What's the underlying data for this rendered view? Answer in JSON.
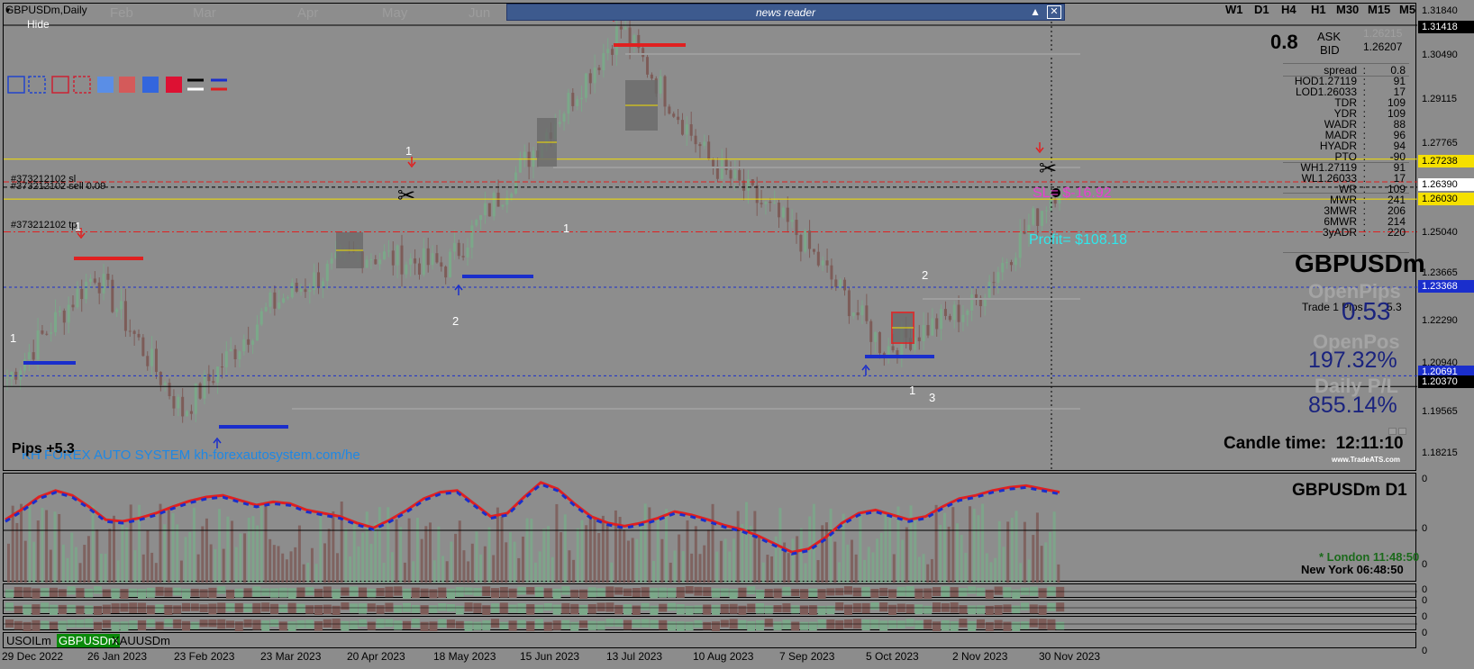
{
  "window": {
    "symbol_title": "GBPUSDm,Daily",
    "hide_label": "Hide"
  },
  "news_reader": {
    "title": "news reader"
  },
  "timeframes": [
    "W1",
    "D1",
    "H4",
    "H1",
    "M30",
    "M15",
    "M5"
  ],
  "month_labels": [
    "Feb",
    "Mar",
    "Apr",
    "May",
    "Jun"
  ],
  "price_axis": {
    "labels": [
      "1.31840",
      "1.31418",
      "1.30490",
      "1.29115",
      "1.27765",
      "1.27238",
      "1.26390",
      "1.26030",
      "1.25040",
      "1.23665",
      "1.23368",
      "1.22290",
      "1.20940",
      "1.20691",
      "1.20370",
      "1.19565",
      "1.18215"
    ],
    "indicator_labels": [
      "0",
      "0",
      "0",
      "0",
      "0",
      "0",
      "0",
      "0"
    ]
  },
  "quote_panel": {
    "spread_big": "0.8",
    "ask_label": "ASK",
    "ask_value": "1.26215",
    "bid_label": "BID",
    "bid_value": "1.26207"
  },
  "stats": [
    {
      "k": "spread",
      "v": "0.8"
    },
    {
      "k": "HOD1.27119",
      "v": "91"
    },
    {
      "k": "LOD1.26033",
      "v": "17"
    },
    {
      "k": "TDR",
      "v": "109"
    },
    {
      "k": "YDR",
      "v": "109"
    },
    {
      "k": "WADR",
      "v": "88"
    },
    {
      "k": "MADR",
      "v": "96"
    },
    {
      "k": "HYADR",
      "v": "94"
    },
    {
      "k": "PTO",
      "v": "-90"
    },
    {
      "k": "WH1.27119",
      "v": "91"
    },
    {
      "k": "WL1.26033",
      "v": "17"
    },
    {
      "k": "WR",
      "v": "109"
    },
    {
      "k": "MWR",
      "v": "241"
    },
    {
      "k": "3MWR",
      "v": "206"
    },
    {
      "k": "6MWR",
      "v": "214"
    },
    {
      "k": "3yADR",
      "v": "220"
    }
  ],
  "summary": {
    "symbol": "GBPUSDm",
    "open_pips_label": "OpenPips",
    "trade_line": "Trade 1 Pips",
    "trade_value": "5.3",
    "open_pips_value": "0.53",
    "open_pos_label": "OpenPos",
    "open_pos_value": "197.32%",
    "daily_pl_label": "Daily P/L",
    "daily_pl_value": "855.14%",
    "candle_time_label": "Candle time:",
    "candle_time_value": "12:11:10",
    "watermark": "www.TradeATS.com"
  },
  "chart_texts": {
    "order_sl": "#373212102 sl",
    "order_sell": "#373212102 sell 0.09",
    "order_tp": "#373212102 tp",
    "sl_money": "SL= $-16.92",
    "profit": "Profit= $108.18",
    "pips": "Pips +5.3",
    "banner": "KH FOREX AUTO SYSTEM  kh-forexautosystem.com/he",
    "wave_labels": [
      "1",
      "1",
      "2",
      "1",
      "2",
      "1",
      "3",
      "1"
    ]
  },
  "subwindow": {
    "title": "GBPUSDm  D1",
    "london": "* London 11:48:50",
    "newyork": "New York 06:48:50"
  },
  "symbol_tabs": [
    {
      "label": "USOILm",
      "active": false
    },
    {
      "label": "GBPUSDm",
      "active": true
    },
    {
      "label": "XAUUSDm",
      "active": false
    }
  ],
  "time_axis": [
    "29 Dec 2022",
    "26 Jan 2023",
    "23 Feb 2023",
    "23 Mar 2023",
    "20 Apr 2023",
    "18 May 2023",
    "15 Jun 2023",
    "13 Jul 2023",
    "10 Aug 2023",
    "7 Sep 2023",
    "5 Oct 2023",
    "2 Nov 2023",
    "30 Nov 2023"
  ],
  "colors": {
    "bull": "#7ba889",
    "bear": "#7d5c58",
    "bg": "#8d8d8d",
    "accent_yellow": "#f5e000",
    "accent_red": "#e02020",
    "accent_blue": "#1a2ecc",
    "news_bar": "#3d5a8e"
  },
  "chart_data": {
    "type": "candlestick",
    "symbol": "GBPUSDm",
    "timeframe": "D1",
    "x": [
      "29 Dec 2022",
      "26 Jan 2023",
      "23 Feb 2023",
      "23 Mar 2023",
      "20 Apr 2023",
      "18 May 2023",
      "15 Jun 2023",
      "13 Jul 2023",
      "10 Aug 2023",
      "7 Sep 2023",
      "5 Oct 2023",
      "2 Nov 2023",
      "30 Nov 2023"
    ],
    "close_approx": [
      1.206,
      1.238,
      1.196,
      1.228,
      1.244,
      1.24,
      1.275,
      1.312,
      1.272,
      1.25,
      1.215,
      1.228,
      1.265
    ],
    "ylim": [
      1.182,
      1.318
    ],
    "levels": {
      "sell_entry": 1.2639,
      "stop_loss": 1.2655,
      "take_profit": 1.2504,
      "yellow_upper": 1.27238,
      "yellow_lower": 1.2603,
      "blue_1": 1.23368,
      "blue_2": 1.20691,
      "black": 1.2037
    },
    "grid": false
  }
}
